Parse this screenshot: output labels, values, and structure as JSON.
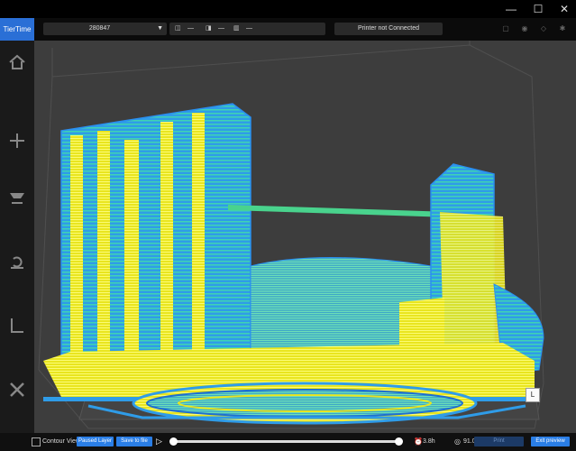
{
  "window": {
    "minimize_glyph": "—",
    "maximize_glyph": "☐",
    "close_glyph": "✕"
  },
  "header": {
    "logo": "TierTime",
    "model_name": "280847",
    "dims": [
      {
        "icon": "width-icon",
        "glyph": "◫",
        "value": "—"
      },
      {
        "icon": "depth-icon",
        "glyph": "◨",
        "value": "—"
      },
      {
        "icon": "height-icon",
        "glyph": "▥",
        "value": "—"
      }
    ],
    "printer_status": "Printer not Connected",
    "right_icons": [
      "printer-icon",
      "camera-icon",
      "gem-icon",
      "settings-icon"
    ]
  },
  "sidebar": {
    "items": [
      "home",
      "add",
      "print",
      "maintenance",
      "calibrate",
      "tools"
    ]
  },
  "viewport": {
    "view_cube_label": "L",
    "colors": {
      "background": "#3d3d3d",
      "shell": "#2f9ce8",
      "infill": "#3fd3b3",
      "support": "#ffff33"
    }
  },
  "footer": {
    "contour_view_label": "Contour View",
    "contour_view_checked": false,
    "paused_layer_label": "Paused Layer",
    "save_to_file_label": "Save to file",
    "play_glyph": "▷",
    "layer_slider_position": 0,
    "layer_slider_max_position": 1,
    "print_time": "3.8h",
    "material_weight": "91.0g",
    "print_label": "Print",
    "exit_preview_label": "Exit preview"
  }
}
